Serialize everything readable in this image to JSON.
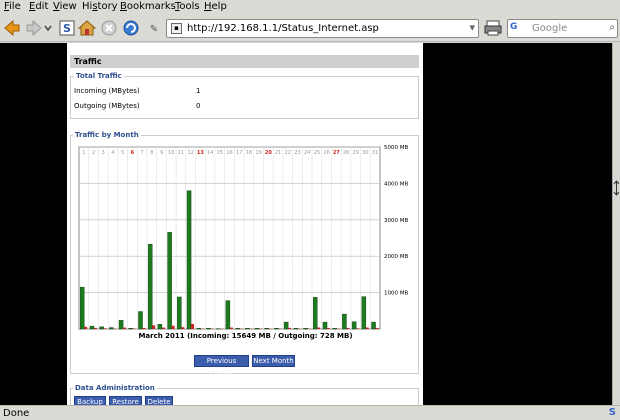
{
  "menu": [
    {
      "pre": "",
      "u": "F",
      "post": "ile"
    },
    {
      "pre": "",
      "u": "E",
      "post": "dit"
    },
    {
      "pre": "",
      "u": "V",
      "post": "iew"
    },
    {
      "pre": "Hi",
      "u": "s",
      "post": "tory"
    },
    {
      "pre": "",
      "u": "B",
      "post": "ookmarks"
    },
    {
      "pre": "",
      "u": "T",
      "post": "ools"
    },
    {
      "pre": "",
      "u": "H",
      "post": "elp"
    }
  ],
  "url": "http://192.168.1.1/Status_Internet.asp",
  "search": {
    "placeholder": "Google",
    "engine": "G"
  },
  "status": "Done",
  "traffic": {
    "title": "Traffic",
    "total_legend": "Total Traffic",
    "incoming_label": "Incoming (MBytes)",
    "incoming_value": "1",
    "outgoing_label": "Outgoing (MBytes)",
    "outgoing_value": "0",
    "month_legend": "Traffic by Month",
    "caption": "March 2011 (Incoming: 15649 MB / Outgoing: 728 MB)",
    "prev_button": "Previous Month",
    "next_button": "Next Month"
  },
  "admin": {
    "legend": "Data Administration",
    "buttons": [
      "Backup",
      "Restore",
      "Delete"
    ]
  },
  "chart_data": {
    "type": "bar",
    "title": "March 2011 (Incoming: 15649 MB / Outgoing: 728 MB)",
    "categories": [
      "1",
      "2",
      "3",
      "4",
      "5",
      "6",
      "7",
      "8",
      "9",
      "10",
      "11",
      "12",
      "13",
      "14",
      "15",
      "16",
      "17",
      "18",
      "19",
      "20",
      "21",
      "22",
      "23",
      "24",
      "25",
      "26",
      "27",
      "28",
      "29",
      "30",
      "31"
    ],
    "weekend_days": [
      6,
      13,
      20,
      27
    ],
    "y_ticks": [
      "1000 MB",
      "2000 MB",
      "3000 MB",
      "4000 MB",
      "5000 MB"
    ],
    "ylim": [
      0,
      5000
    ],
    "series": [
      {
        "name": "Incoming",
        "color": "#1e7a1e",
        "values": [
          1150,
          80,
          60,
          40,
          240,
          20,
          480,
          2330,
          130,
          2660,
          880,
          3800,
          20,
          20,
          10,
          780,
          20,
          20,
          20,
          20,
          20,
          190,
          20,
          20,
          870,
          190,
          20,
          410,
          200,
          890,
          190
        ]
      },
      {
        "name": "Outgoing",
        "color": "#cc2222",
        "values": [
          60,
          30,
          20,
          10,
          40,
          10,
          30,
          100,
          40,
          90,
          50,
          140,
          10,
          10,
          5,
          40,
          10,
          10,
          10,
          10,
          10,
          30,
          10,
          10,
          40,
          30,
          10,
          30,
          20,
          40,
          30
        ]
      }
    ],
    "grid": true
  },
  "colors": {
    "button": "#3b5dab",
    "legend": "#2f4f8f",
    "weekend": "#cc2222"
  }
}
